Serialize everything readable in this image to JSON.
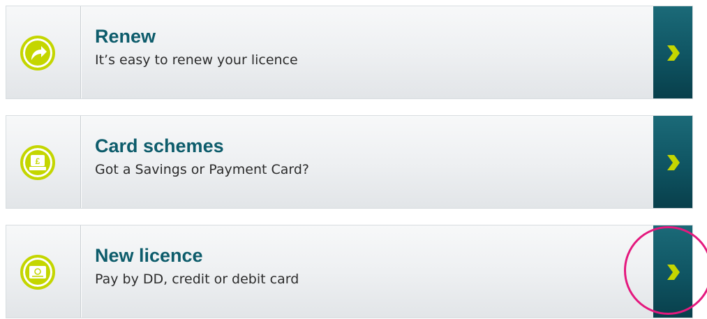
{
  "colors": {
    "title": "#0d5c6b",
    "subtitle": "#2b2b2b",
    "icon_green": "#c4d600",
    "arrow_bg": "#0f5462",
    "highlight": "#e4197e"
  },
  "cards": [
    {
      "title": "Renew",
      "subtitle": "It’s easy to renew your licence",
      "icon": "renew-arrow-icon"
    },
    {
      "title": "Card schemes",
      "subtitle": "Got a Savings or Payment Card?",
      "icon": "payment-card-pound-icon"
    },
    {
      "title": "New licence",
      "subtitle": "Pay by DD, credit or debit card",
      "icon": "tv-licence-card-icon"
    }
  ],
  "annotation": {
    "highlighted_element": "new-licence-arrow-button"
  }
}
